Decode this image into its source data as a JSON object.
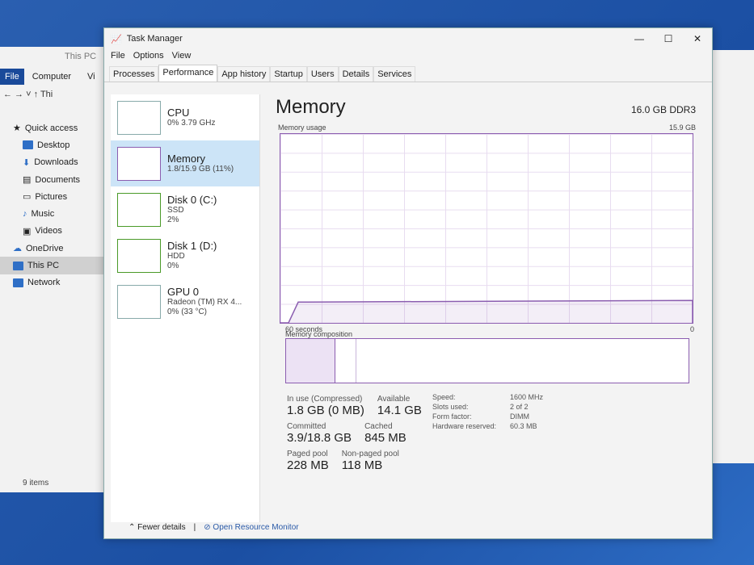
{
  "explorer": {
    "title": "This PC",
    "ribbon": [
      "File",
      "Computer",
      "Vi"
    ],
    "address": "Thi",
    "nav": [
      "Quick access",
      "Desktop",
      "Downloads",
      "Documents",
      "Pictures",
      "Music",
      "Videos",
      "OneDrive",
      "This PC",
      "Network"
    ],
    "status": "9 items"
  },
  "tm": {
    "title": "Task Manager",
    "menu": [
      "File",
      "Options",
      "View"
    ],
    "tabs": [
      "Processes",
      "Performance",
      "App history",
      "Startup",
      "Users",
      "Details",
      "Services"
    ],
    "side": [
      {
        "name": "CPU",
        "sub1": "0% 3.79 GHz",
        "sub2": ""
      },
      {
        "name": "Memory",
        "sub1": "1.8/15.9 GB (11%)",
        "sub2": ""
      },
      {
        "name": "Disk 0 (C:)",
        "sub1": "SSD",
        "sub2": "2%"
      },
      {
        "name": "Disk 1 (D:)",
        "sub1": "HDD",
        "sub2": "0%"
      },
      {
        "name": "GPU 0",
        "sub1": "Radeon (TM) RX 4...",
        "sub2": "0% (33 °C)"
      }
    ],
    "heading": "Memory",
    "spec": "16.0 GB DDR3",
    "usage_label": "Memory usage",
    "usage_max": "15.9 GB",
    "time_label": "60 seconds",
    "zero": "0",
    "comp_label": "Memory composition",
    "usage_fraction": 0.11,
    "stats": {
      "inuse_l": "In use (Compressed)",
      "inuse_v": "1.8 GB (0 MB)",
      "avail_l": "Available",
      "avail_v": "14.1 GB",
      "comm_l": "Committed",
      "comm_v": "3.9/18.8 GB",
      "cache_l": "Cached",
      "cache_v": "845 MB",
      "paged_l": "Paged pool",
      "paged_v": "228 MB",
      "np_l": "Non-paged pool",
      "np_v": "118 MB"
    },
    "hw": [
      [
        "Speed:",
        "1600 MHz"
      ],
      [
        "Slots used:",
        "2 of 2"
      ],
      [
        "Form factor:",
        "DIMM"
      ],
      [
        "Hardware reserved:",
        "60.3 MB"
      ]
    ],
    "footer": {
      "fewer": "Fewer details",
      "monitor": "Open Resource Monitor"
    }
  }
}
